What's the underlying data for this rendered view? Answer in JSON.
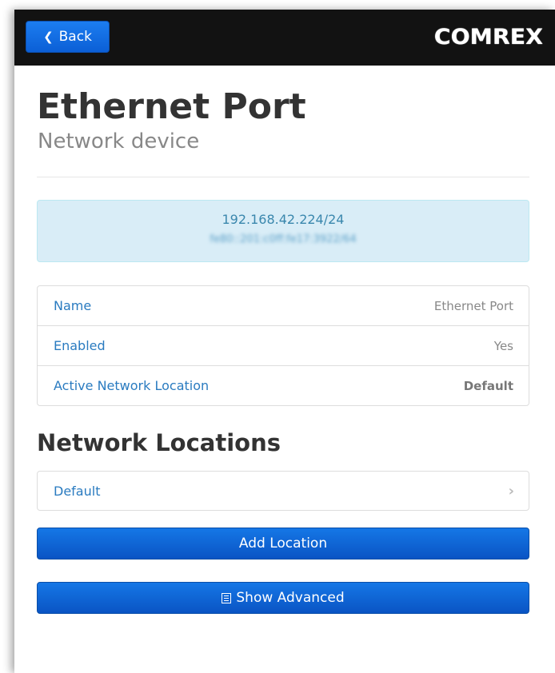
{
  "topbar": {
    "back_label": "Back",
    "back_icon": "chevron-left-icon",
    "logo_text": "COMREX"
  },
  "header": {
    "title": "Ethernet Port",
    "subtitle": "Network device"
  },
  "addresses": {
    "ipv4": "192.168.42.224/24",
    "ipv6": "fe80::201:c0ff:fe17:3922/64"
  },
  "info": {
    "rows": [
      {
        "label": "Name",
        "value": "Ethernet Port"
      },
      {
        "label": "Enabled",
        "value": "Yes"
      },
      {
        "label": "Active Network Location",
        "value": "Default"
      }
    ]
  },
  "locations": {
    "title": "Network Locations",
    "items": [
      {
        "label": "Default",
        "icon": "chevron-right-icon"
      }
    ]
  },
  "actions": {
    "add_location_label": "Add Location",
    "show_advanced_label": "Show Advanced",
    "show_advanced_icon": "list-icon"
  },
  "colors": {
    "topbar": "#121212",
    "primary_button": "#0b62d6",
    "link": "#2a7bc0",
    "alert_bg": "#d9edf7",
    "alert_text": "#3a87ad"
  }
}
